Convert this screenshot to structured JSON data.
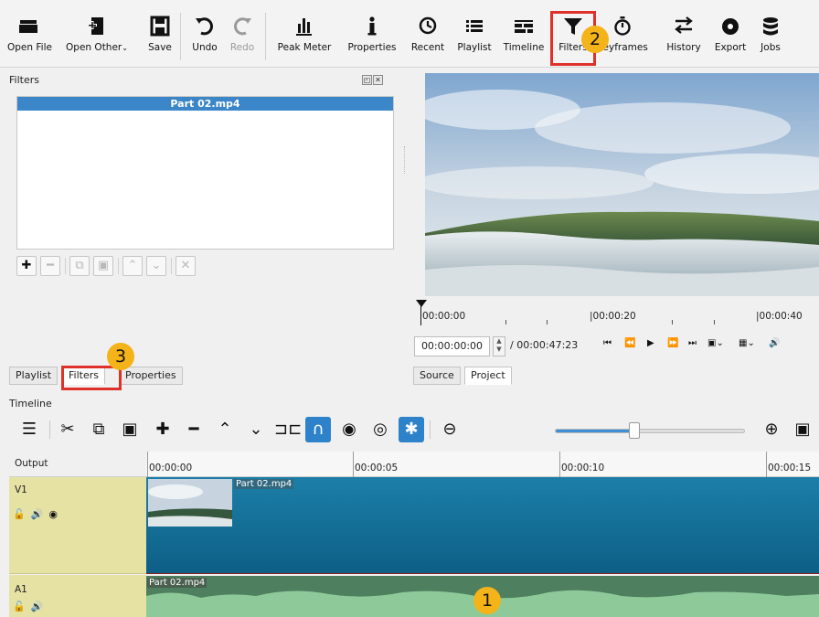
{
  "toolbar": {
    "buttons": [
      {
        "label": "Open File",
        "icon": "folder-icon"
      },
      {
        "label": "Open Other",
        "icon": "open-other-icon"
      },
      {
        "label": "Save",
        "icon": "save-icon"
      },
      {
        "label": "Undo",
        "icon": "undo-icon"
      },
      {
        "label": "Redo",
        "icon": "redo-icon"
      },
      {
        "label": "Peak Meter",
        "icon": "peak-meter-icon"
      },
      {
        "label": "Properties",
        "icon": "info-icon"
      },
      {
        "label": "Recent",
        "icon": "clock-icon"
      },
      {
        "label": "Playlist",
        "icon": "list-icon"
      },
      {
        "label": "Timeline",
        "icon": "timeline-icon"
      },
      {
        "label": "Filters",
        "icon": "funnel-icon"
      },
      {
        "label": "Keyframes",
        "icon": "stopwatch-icon"
      },
      {
        "label": "History",
        "icon": "history-icon"
      },
      {
        "label": "Export",
        "icon": "export-icon"
      },
      {
        "label": "Jobs",
        "icon": "jobs-icon"
      }
    ]
  },
  "filters_panel": {
    "title": "Filters",
    "selected_clip": "Part 02.mp4"
  },
  "left_tabs": [
    "Playlist",
    "Filters",
    "Properties"
  ],
  "viewer": {
    "ruler_labels": [
      "00:00:00",
      "|00:00:20",
      "|00:00:40"
    ],
    "timecode": "00:00:00:00",
    "duration": "/ 00:00:47:23",
    "tabs": [
      "Source",
      "Project"
    ]
  },
  "timeline": {
    "title": "Timeline",
    "zoom_level": 0.42,
    "ruler_labels": [
      "00:00:00",
      "00:00:05",
      "00:00:10",
      "00:00:15"
    ],
    "tracks": {
      "output": "Output",
      "v1": "V1",
      "a1": "A1"
    },
    "v1_clip": "Part 02.mp4",
    "a1_clip": "Part 02.mp4"
  },
  "callouts": [
    "1",
    "2",
    "3"
  ],
  "colors": {
    "accent": "#3a86c8",
    "callout_fill": "#f5b31a",
    "callout_border": "#e0302a",
    "video_track": "#1c7fa8",
    "audio_track": "#4e7f5e",
    "track_header": "#e6e2a4"
  }
}
